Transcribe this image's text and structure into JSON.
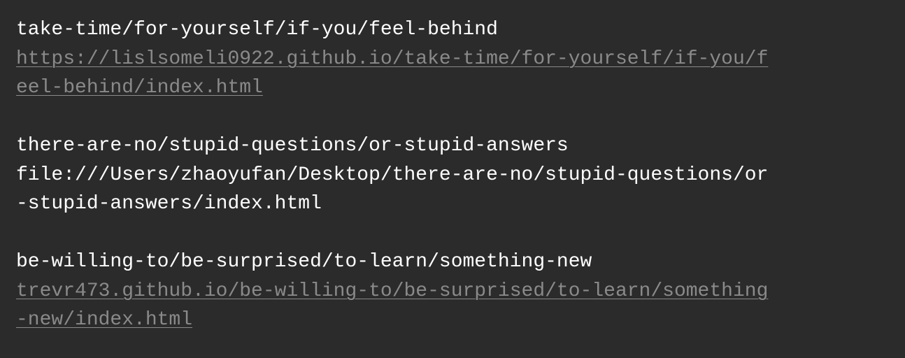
{
  "entries": [
    {
      "title": "take-time/for-yourself/if-you/feel-behind",
      "url_lines": [
        "https://lislsomeli0922.github.io/take-time/for-yourself/if-you/f",
        "eel-behind/index.html"
      ],
      "is_link": true
    },
    {
      "title": "there-are-no/stupid-questions/or-stupid-answers",
      "url_lines": [
        "file:///Users/zhaoyufan/Desktop/there-are-no/stupid-questions/or",
        "-stupid-answers/index.html"
      ],
      "is_link": false
    },
    {
      "title": "be-willing-to/be-surprised/to-learn/something-new",
      "url_lines": [
        "trevr473.github.io/be-willing-to/be-surprised/to-learn/something",
        "-new/index.html"
      ],
      "is_link": true
    }
  ],
  "colors": {
    "background": "#2b2b2b",
    "title_text": "#ffffff",
    "link_text": "#8a8a8a",
    "plain_url_text": "#ffffff"
  }
}
